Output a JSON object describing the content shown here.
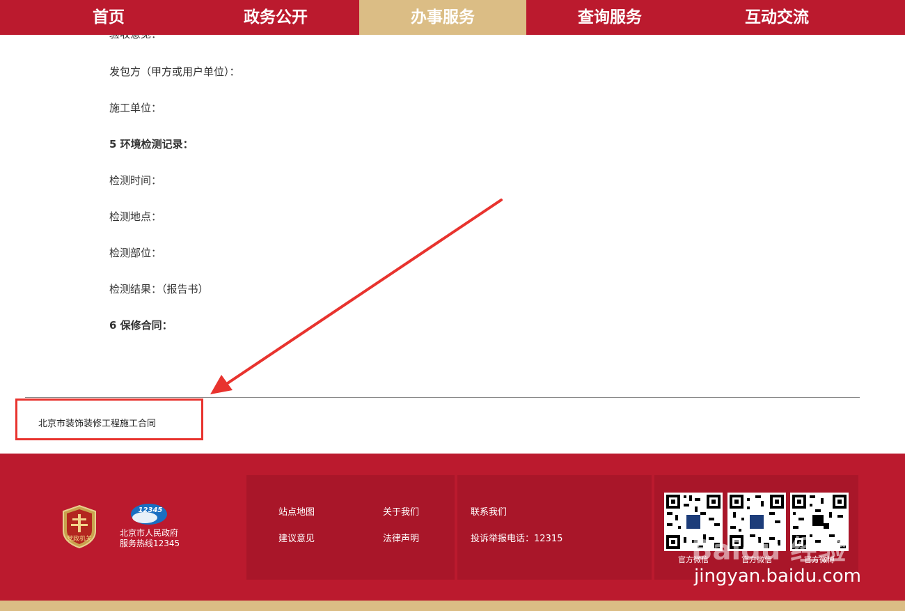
{
  "nav": {
    "tabs": [
      {
        "label": "首页"
      },
      {
        "label": "政务公开"
      },
      {
        "label": "办事服务",
        "active": true
      },
      {
        "label": "查询服务"
      },
      {
        "label": "互动交流"
      }
    ]
  },
  "content": {
    "cut_line": "验收意见：",
    "lines": [
      {
        "text": "发包方（甲方或用户单位）：",
        "bold": false
      },
      {
        "text": "施工单位：",
        "bold": false
      },
      {
        "text": "5 环境检测记录：",
        "bold": true
      },
      {
        "text": "检测时间：",
        "bold": false
      },
      {
        "text": "检测地点：",
        "bold": false
      },
      {
        "text": "检测部位：",
        "bold": false
      },
      {
        "text": "检测结果：（报告书）",
        "bold": false
      },
      {
        "text": "6  保修合同：",
        "bold": true
      }
    ],
    "doc_title": "北京市装饰装修工程施工合同"
  },
  "colors": {
    "nav_red": "#bb1a2e",
    "active_gold": "#dbbd85",
    "panel_red": "#a91629",
    "highlight_red": "#e8332e"
  },
  "footer": {
    "badge_text": "党政机关",
    "hotline_logo_text": "12345",
    "hotline_line1": "北京市人民政府",
    "hotline_line2": "服务热线12345",
    "links_col1": [
      "站点地图",
      "建议意见"
    ],
    "links_col2": [
      "关于我们",
      "法律声明"
    ],
    "contact_label": "联系我们",
    "complaint_phone": "投诉举报电话：12315",
    "qr_captions": [
      "官方微信",
      "官方微信",
      "官方微博"
    ],
    "watermark": "Baidu 经验",
    "watermark_url": "jingyan.baidu.com"
  }
}
